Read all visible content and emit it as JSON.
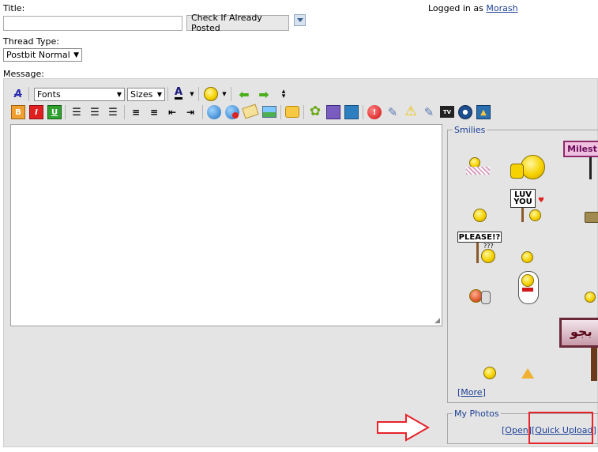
{
  "title_label": "Title:",
  "check_button": "Check If Already Posted",
  "logged_in": {
    "prefix": "Logged in as ",
    "user": "Morash"
  },
  "thread_type": {
    "label": "Thread Type:",
    "selected": "Postbit Normal"
  },
  "message_label": "Message:",
  "toolbar": {
    "font_select": "Fonts",
    "size_select": "Sizes",
    "bold": "B",
    "italic": "I",
    "underline": "U",
    "text_color": "A"
  },
  "smilies": {
    "legend": "Smilies",
    "luv_sign": "LUV YOU",
    "please_sign": "PLEASE!?",
    "milestone_sign": "Milest",
    "more_link": "More"
  },
  "photos": {
    "legend": "My Photos",
    "open_link": "Open",
    "quick_upload_link": "Quick Upload"
  },
  "annotation_color": "#e8232a"
}
